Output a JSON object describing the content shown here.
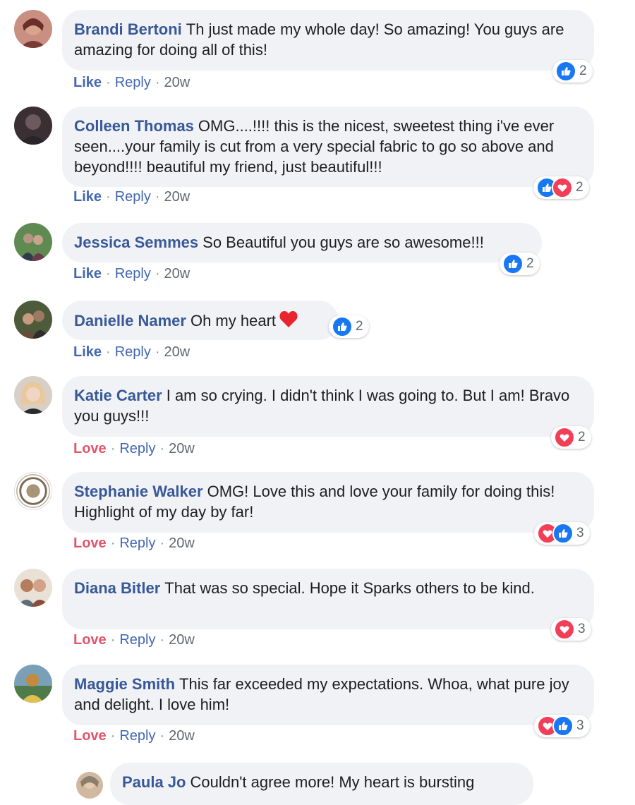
{
  "comments": [
    {
      "author": "Brandi Bertoni",
      "text": "Th just made my whole day! So amazing! You guys are amazing for doing all of this!",
      "action": "Like",
      "reply": "Reply",
      "time": "20w",
      "reactions": [
        "like"
      ],
      "reaction_count": "2",
      "avatar_colors": [
        "#7a3b35",
        "#d9a48c"
      ]
    },
    {
      "author": "Colleen Thomas",
      "text": "OMG....!!!! this is the nicest, sweetest thing i've ever seen....your family is cut from a very special fabric to go so above and beyond!!!! beautiful my friend, just beautiful!!!",
      "action": "Like",
      "reply": "Reply",
      "time": "20w",
      "reactions": [
        "like",
        "love"
      ],
      "reaction_count": "2",
      "avatar_colors": [
        "#2b2428",
        "#6e5a5e"
      ]
    },
    {
      "author": "Jessica Semmes",
      "text": "So Beautiful you guys are so awesome!!!",
      "action": "Like",
      "reply": "Reply",
      "time": "20w",
      "reactions": [
        "like"
      ],
      "reaction_count": "2",
      "avatar_colors": [
        "#3d6a3a",
        "#b49583"
      ]
    },
    {
      "author": "Danielle Namer",
      "text": "Oh my heart",
      "action": "Like",
      "reply": "Reply",
      "time": "20w",
      "reactions": [
        "like"
      ],
      "reaction_count": "2",
      "avatar_colors": [
        "#4d5b3b",
        "#9a7a62"
      ]
    },
    {
      "author": "Katie Carter",
      "text": "I am so crying. I didn't think I was going to. But I am! Bravo you guys!!!",
      "action": "Love",
      "reply": "Reply",
      "time": "20w",
      "reactions": [
        "love"
      ],
      "reaction_count": "2",
      "avatar_colors": [
        "#d8cfc6",
        "#e8c89c"
      ]
    },
    {
      "author": "Stephanie Walker",
      "text": "OMG! Love this and love your family for doing this! Highlight of my day by far!",
      "action": "Love",
      "reply": "Reply",
      "time": "20w",
      "reactions": [
        "love",
        "like"
      ],
      "reaction_count": "3",
      "avatar_colors": [
        "#ffffff",
        "#7b6a56"
      ]
    },
    {
      "author": "Diana Bitler",
      "text": "That was so special. Hope it Sparks others to be kind.",
      "action": "Love",
      "reply": "Reply",
      "time": "20w",
      "reactions": [
        "love"
      ],
      "reaction_count": "3",
      "avatar_colors": [
        "#b57c5d",
        "#5a6f7a"
      ]
    },
    {
      "author": "Maggie Smith",
      "text": "This far exceeded my expectations. Whoa, what pure joy and delight. I love him!",
      "action": "Love",
      "reply": "Reply",
      "time": "20w",
      "reactions": [
        "love",
        "like"
      ],
      "reaction_count": "3",
      "avatar_colors": [
        "#c48a3d",
        "#4f7a4a"
      ]
    }
  ],
  "reply_preview": {
    "author": "Paula Jo",
    "text": "Couldn't agree more! My heart is bursting",
    "avatar_colors": [
      "#8a7f6c",
      "#d1b9a0"
    ]
  }
}
